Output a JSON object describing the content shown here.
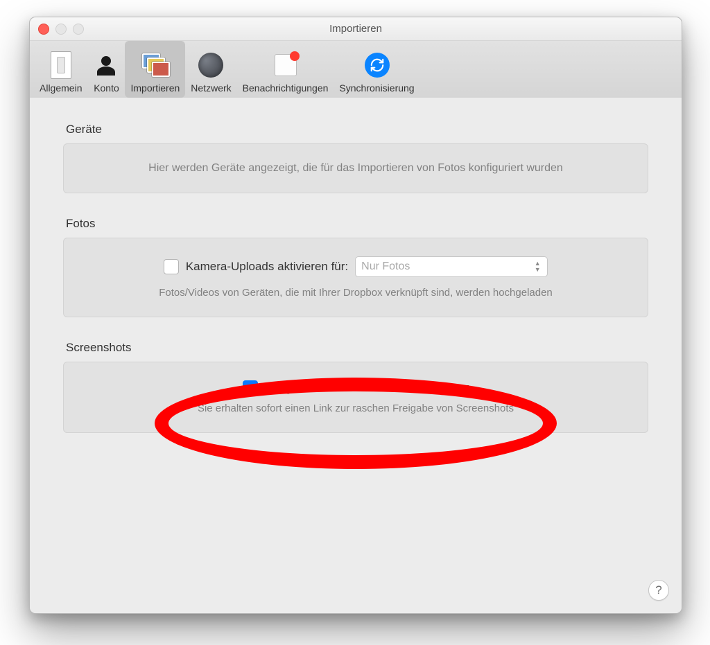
{
  "window": {
    "title": "Importieren"
  },
  "tabs": {
    "general": "Allgemein",
    "account": "Konto",
    "import": "Importieren",
    "network": "Netzwerk",
    "notifications": "Benachrichtigungen",
    "sync": "Synchronisierung"
  },
  "devices": {
    "heading": "Geräte",
    "empty": "Hier werden Geräte angezeigt, die für das Importieren von Fotos konfiguriert wurden"
  },
  "photos": {
    "heading": "Fotos",
    "checkbox_label": "Kamera-Uploads aktivieren für:",
    "select_value": "Nur Fotos",
    "note": "Fotos/Videos von Geräten, die mit Ihrer Dropbox verknüpft sind, werden hochgeladen"
  },
  "screenshots": {
    "heading": "Screenshots",
    "checkbox_label": "Freigabe von Screenshots mit Dropbox",
    "note": "Sie erhalten sofort einen Link zur raschen Freigabe von Screenshots"
  },
  "help": {
    "label": "?"
  }
}
